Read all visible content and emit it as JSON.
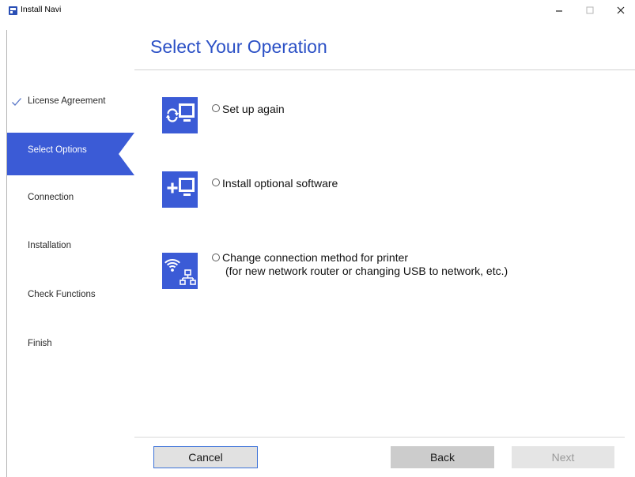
{
  "window": {
    "title": "Install Navi",
    "app_icon": "install-navi-app-icon",
    "controls": {
      "minimize": "minimize-icon",
      "maximize": "maximize-icon",
      "close": "close-icon"
    }
  },
  "sidebar": {
    "completed_icon": "checkmark-icon",
    "items": [
      {
        "label": "License Agreement",
        "completed": true,
        "active": false
      },
      {
        "label": "Select Options",
        "completed": false,
        "active": true
      },
      {
        "label": "Connection",
        "completed": false,
        "active": false
      },
      {
        "label": "Installation",
        "completed": false,
        "active": false
      },
      {
        "label": "Check Functions",
        "completed": false,
        "active": false
      },
      {
        "label": "Finish",
        "completed": false,
        "active": false
      }
    ]
  },
  "main": {
    "title": "Select Your Operation",
    "options": [
      {
        "label": "Set up again",
        "icon": "setup-again-icon",
        "selected": false
      },
      {
        "label": "Install optional software",
        "icon": "install-software-icon",
        "selected": false
      },
      {
        "label": "Change connection method for printer",
        "note": "(for new network router or changing USB to network, etc.)",
        "icon": "change-connection-icon",
        "selected": false
      }
    ]
  },
  "footer": {
    "cancel_label": "Cancel",
    "back_label": "Back",
    "next_label": "Next",
    "next_enabled": false
  },
  "colors": {
    "accent": "#3b5bd6",
    "title": "#2c51c6",
    "active_item_text": "#ffffff",
    "button_focus_border": "#3c72d8",
    "disabled_text": "#9a9a9a",
    "check_mark": "#5a78c9"
  }
}
